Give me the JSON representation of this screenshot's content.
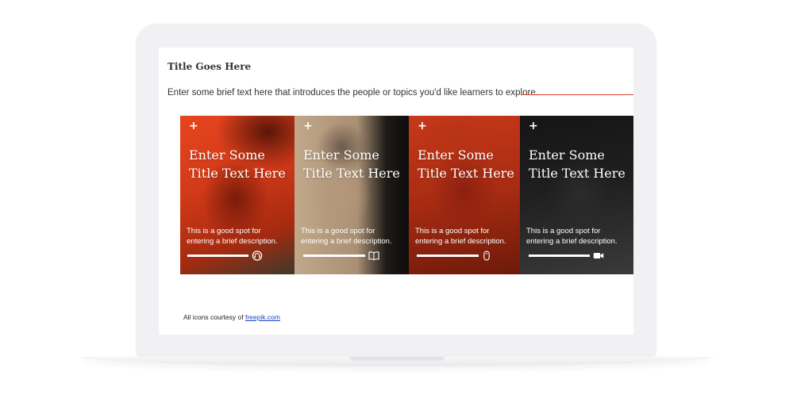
{
  "screen": {
    "title": "Title Goes Here",
    "intro": "Enter some brief text here that introduces the people or topics you'd like learners to explore."
  },
  "cards": [
    {
      "title_line1": "Enter Some",
      "title_line2": "Title Text Here",
      "desc_line1": "This is a good spot for",
      "desc_line2": "entering a brief description.",
      "icon": "headphones-icon"
    },
    {
      "title_line1": "Enter Some",
      "title_line2": "Title Text Here",
      "desc_line1": "This is a good spot for",
      "desc_line2": "entering a brief description.",
      "icon": "book-icon"
    },
    {
      "title_line1": "Enter Some",
      "title_line2": "Title Text Here",
      "desc_line1": "This is a good spot for",
      "desc_line2": "entering a brief description.",
      "icon": "mouse-icon"
    },
    {
      "title_line1": "Enter Some",
      "title_line2": "Title Text Here",
      "desc_line1": "This is a good spot for",
      "desc_line2": "entering a brief description.",
      "icon": "video-camera-icon"
    }
  ],
  "footer": {
    "credit_prefix": "All icons courtesy of",
    "credit_link": "freepik.com"
  },
  "colors": {
    "accent_rule": "#d9402b",
    "link": "#1a3fd1"
  }
}
